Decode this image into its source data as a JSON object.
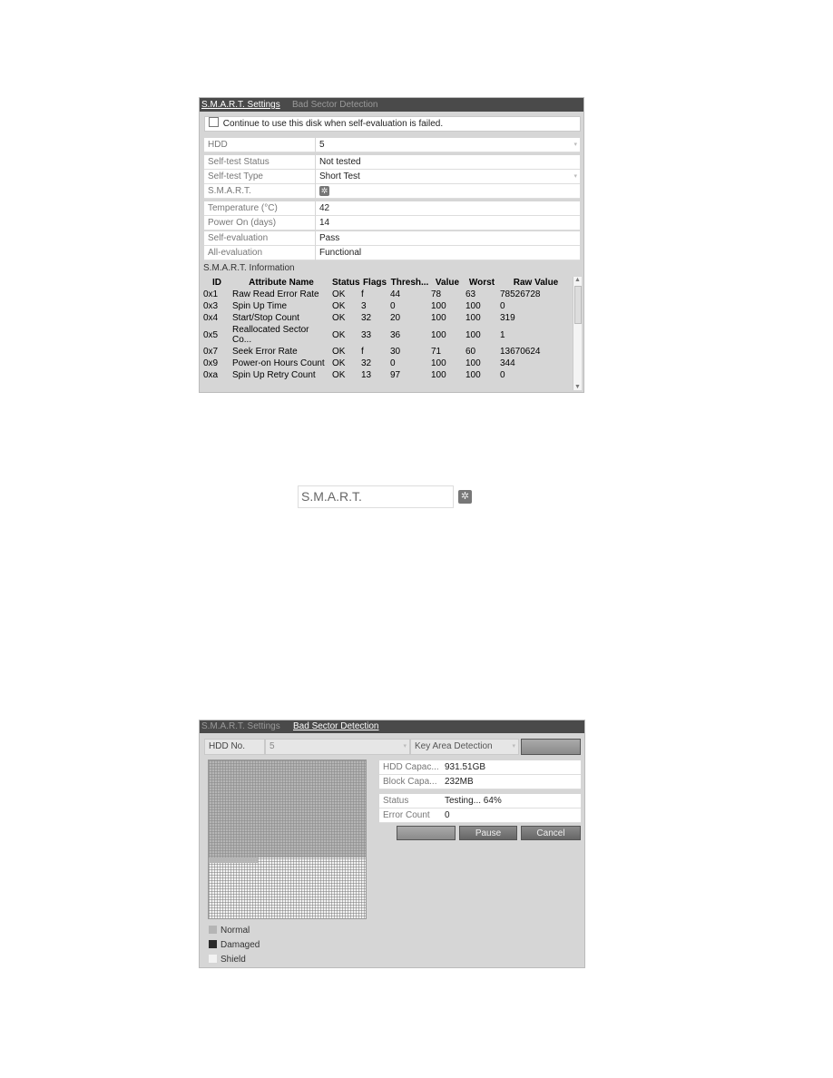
{
  "smart_settings": {
    "tabs": [
      "S.M.A.R.T. Settings",
      "Bad Sector Detection"
    ],
    "continue_checkbox": {
      "label": "Continue to use this disk when self-evaluation is failed.",
      "checked": false
    },
    "fields": [
      {
        "label": "HDD",
        "value": "5",
        "dropdown": true
      },
      {
        "label": "Self-test Status",
        "value": "Not tested"
      },
      {
        "label": "Self-test Type",
        "value": "Short Test",
        "dropdown": true
      },
      {
        "label": "S.M.A.R.T.",
        "value": "",
        "icon": "gear-icon"
      },
      {
        "label": "Temperature (°C)",
        "value": "42"
      },
      {
        "label": "Power On (days)",
        "value": "14"
      },
      {
        "label": "Self-evaluation",
        "value": "Pass"
      },
      {
        "label": "All-evaluation",
        "value": "Functional"
      }
    ],
    "info_title": "S.M.A.R.T. Information",
    "columns": [
      "ID",
      "Attribute Name",
      "Status",
      "Flags",
      "Thresh...",
      "Value",
      "Worst",
      "Raw Value"
    ],
    "rows": [
      [
        "0x1",
        "Raw Read Error Rate",
        "OK",
        "f",
        "44",
        "78",
        "63",
        "78526728"
      ],
      [
        "0x3",
        "Spin Up Time",
        "OK",
        "3",
        "0",
        "100",
        "100",
        "0"
      ],
      [
        "0x4",
        "Start/Stop Count",
        "OK",
        "32",
        "20",
        "100",
        "100",
        "319"
      ],
      [
        "0x5",
        "Reallocated Sector Co...",
        "OK",
        "33",
        "36",
        "100",
        "100",
        "1"
      ],
      [
        "0x7",
        "Seek Error Rate",
        "OK",
        "f",
        "30",
        "71",
        "60",
        "13670624"
      ],
      [
        "0x9",
        "Power-on Hours Count",
        "OK",
        "32",
        "0",
        "100",
        "100",
        "344"
      ],
      [
        "0xa",
        "Spin Up Retry Count",
        "OK",
        "13",
        "97",
        "100",
        "100",
        "0"
      ]
    ]
  },
  "smart_button": {
    "label": "S.M.A.R.T.",
    "icon": "gear-icon"
  },
  "bad_sector": {
    "tabs": [
      "S.M.A.R.T. Settings",
      "Bad Sector Detection"
    ],
    "hdd_label": "HDD No.",
    "hdd_value": "5",
    "mode": "Key Area Detection",
    "info": [
      {
        "label": "HDD Capac...",
        "value": "931.51GB"
      },
      {
        "label": "Block Capa...",
        "value": "232MB"
      }
    ],
    "status": [
      {
        "label": "Status",
        "value": "Testing... 64%"
      },
      {
        "label": "Error Count",
        "value": "0"
      }
    ],
    "progress_percent": 64,
    "buttons": {
      "pause": "Pause",
      "cancel": "Cancel"
    },
    "legend": [
      {
        "label": "Normal",
        "color": "#b5b5b5"
      },
      {
        "label": "Damaged",
        "color": "#2a2a2a"
      },
      {
        "label": "Shield",
        "color": "#f2f2f2"
      }
    ]
  }
}
